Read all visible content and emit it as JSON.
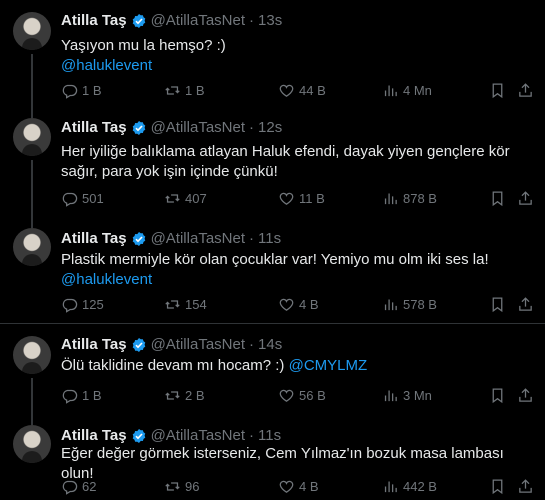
{
  "tweets": [
    {
      "name": "Atilla Taş",
      "handle": "@AtillaTasNet",
      "time": "13s",
      "text": "Yaşıyon mu la hemşo? :)",
      "mention": "@haluklevent",
      "replies": "1 B",
      "retweets": "1 B",
      "likes": "44 B",
      "views": "4 Mn"
    },
    {
      "name": "Atilla Taş",
      "handle": "@AtillaTasNet",
      "time": "12s",
      "text": "Her iyiliğe balıklama atlayan Haluk efendi, dayak yiyen gençlere kör sağır, para yok işin içinde çünkü!",
      "replies": "501",
      "retweets": "407",
      "likes": "11 B",
      "views": "878 B"
    },
    {
      "name": "Atilla Taş",
      "handle": "@AtillaTasNet",
      "time": "11s",
      "text": "Plastik mermiyle kör olan çocuklar var! Yemiyo mu olm iki ses la!",
      "mention": "@haluklevent",
      "replies": "125",
      "retweets": "154",
      "likes": "4 B",
      "views": "578 B"
    },
    {
      "name": "Atilla Taş",
      "handle": "@AtillaTasNet",
      "time": "14s",
      "text": "Ölü taklidine devam mı hocam? :)",
      "mention": "@CMYLMZ",
      "replies": "1 B",
      "retweets": "2 B",
      "likes": "56 B",
      "views": "3 Mn"
    },
    {
      "name": "Atilla Taş",
      "handle": "@AtillaTasNet",
      "time": "11s",
      "text": "Eğer değer görmek isterseniz, Cem Yılmaz'ın bozuk masa lambası olun!",
      "replies": "62",
      "retweets": "96",
      "likes": "4 B",
      "views": "442 B"
    }
  ],
  "separator": "·",
  "colors": {
    "background": "#000000",
    "text": "#e7e9ea",
    "muted": "#71767b",
    "accent": "#1d9bf0",
    "thread_line": "#333639"
  },
  "icons": {
    "reply": "reply-icon",
    "retweet": "retweet-icon",
    "like": "heart-icon",
    "views": "views-icon",
    "bookmark": "bookmark-icon",
    "share": "share-icon",
    "verified": "verified-badge-icon"
  }
}
